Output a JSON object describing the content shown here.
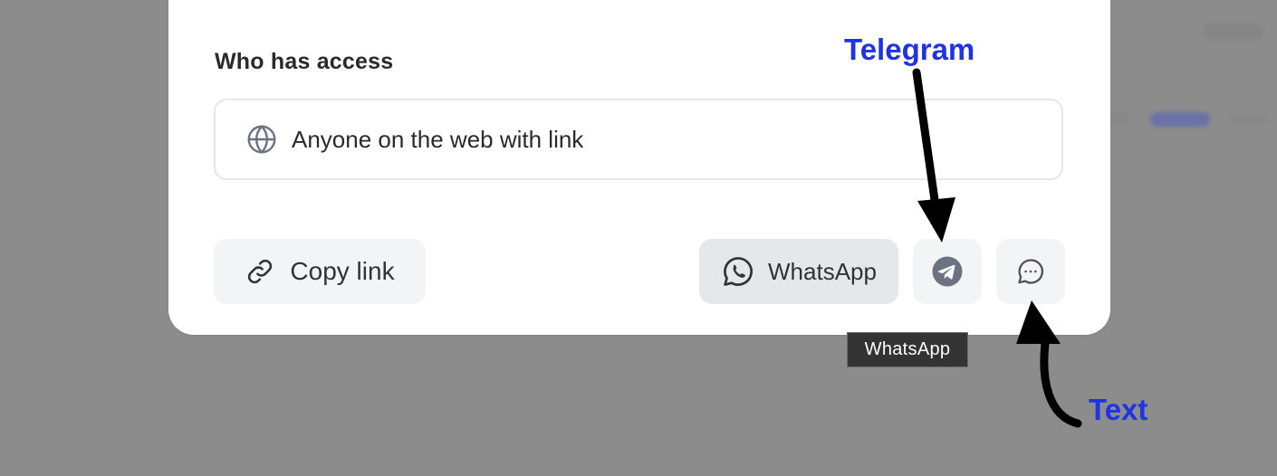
{
  "dialog": {
    "section_title": "Who has access",
    "access_option": {
      "label": "Anyone on the web with link",
      "icon": "globe-icon"
    },
    "buttons": {
      "copy_link": {
        "label": "Copy link",
        "icon": "link-icon"
      },
      "whatsapp": {
        "label": "WhatsApp",
        "icon": "whatsapp-icon"
      },
      "telegram": {
        "icon": "telegram-icon"
      },
      "text_message": {
        "icon": "chat-bubble-icon"
      }
    }
  },
  "tooltip": {
    "text": "WhatsApp"
  },
  "annotations": {
    "telegram_label": "Telegram",
    "text_label": "Text",
    "color": "#1f33e6"
  },
  "colors": {
    "overlay": "#8c8c8c",
    "dialog_bg": "#ffffff",
    "button_bg": "#f3f4f6",
    "button_hover_bg": "#e6e7ea",
    "tooltip_bg": "#333333"
  }
}
